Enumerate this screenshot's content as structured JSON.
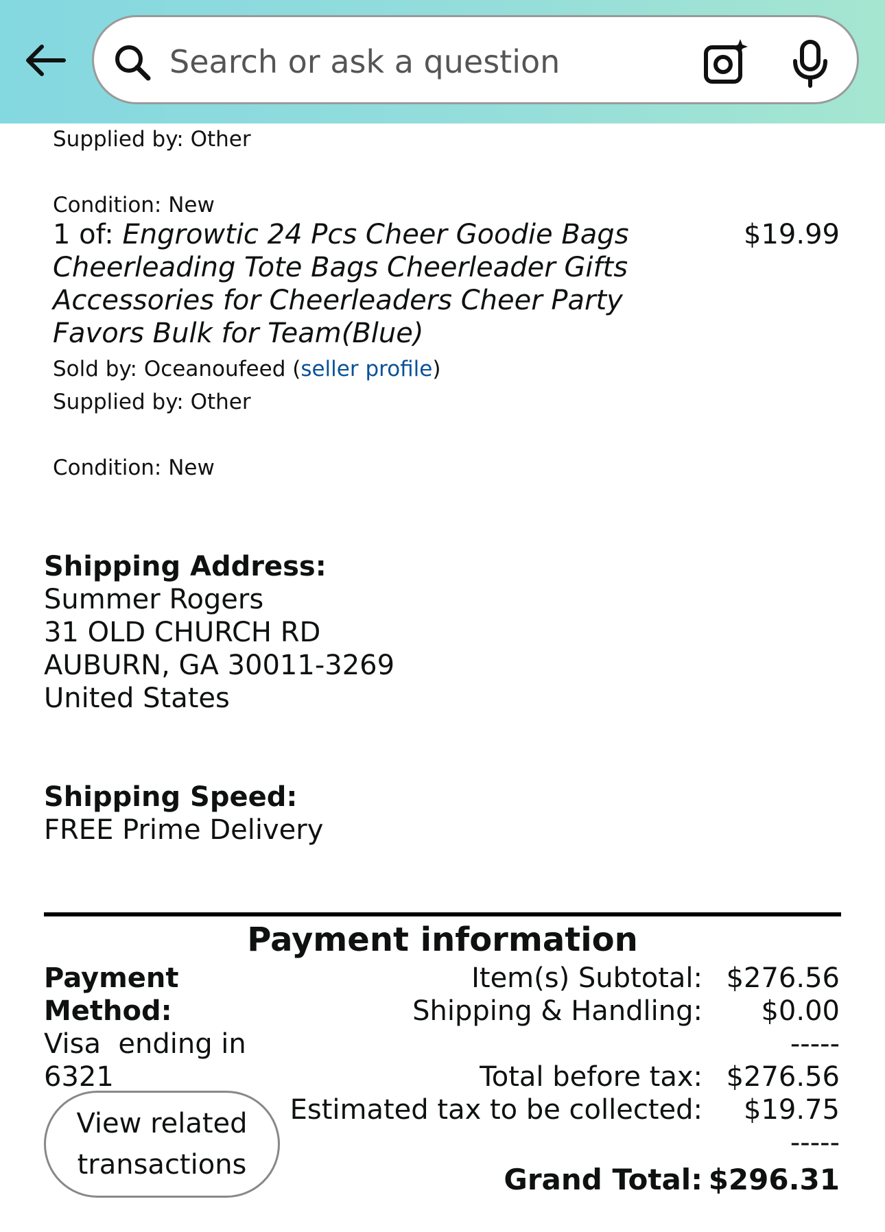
{
  "search": {
    "placeholder": "Search or ask a question"
  },
  "item_prev": {
    "supplied_by": "Supplied by: Other",
    "condition": "Condition: New"
  },
  "item": {
    "quantity_prefix": "1 of: ",
    "title": "Engrowtic 24 Pcs Cheer Goodie Bags Cheerleading Tote Bags Cheerleader Gifts Accessories for Cheerleaders Cheer Party Favors Bulk for Team(Blue)",
    "price": "$19.99",
    "sold_by_prefix": "Sold by: Oceanoufeed (",
    "seller_profile_link": "seller profile",
    "sold_by_suffix": ")",
    "supplied_by": "Supplied by: Other",
    "condition": "Condition: New"
  },
  "shipping_address": {
    "heading": "Shipping Address:",
    "name": "Summer Rogers",
    "line1": "31 OLD CHURCH RD",
    "line2": "AUBURN, GA 30011-3269",
    "country": "United States"
  },
  "shipping_speed": {
    "heading": "Shipping Speed:",
    "value": "FREE Prime Delivery"
  },
  "payment": {
    "title": "Payment information",
    "method_label_1": "Payment",
    "method_label_2": "Method:",
    "method_value_1": "Visa  ending in",
    "method_value_2": "6321",
    "view_button_line1": "View related",
    "view_button_line2": "transactions",
    "rows": [
      {
        "label": "Item(s) Subtotal:",
        "value": "$276.56"
      },
      {
        "label": "Shipping & Handling:",
        "value": "$0.00"
      },
      {
        "label": "",
        "value": "-----"
      },
      {
        "label": "Total before tax:",
        "value": "$276.56"
      },
      {
        "label": "Estimated tax to be collected:",
        "value": "$19.75"
      },
      {
        "label": "",
        "value": "-----"
      }
    ],
    "grand_label": "Grand Total:",
    "grand_value": "$296.31"
  },
  "colors": {
    "topbar_start": "#84d8e0",
    "topbar_end": "#a5e6d0",
    "link": "#0a5299"
  },
  "icons": [
    "back-arrow-icon",
    "search-icon",
    "camera-lens-icon",
    "microphone-icon"
  ]
}
